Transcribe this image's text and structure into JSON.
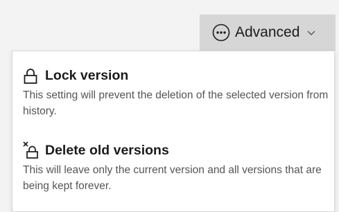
{
  "toolbar": {
    "advanced_label": "Advanced",
    "advanced_icon": "more-options-icon",
    "chevron_icon": "chevron-down-icon"
  },
  "menu": {
    "items": [
      {
        "title": "Lock version",
        "description": "This setting will prevent the deletion of the selected version from history.",
        "icon": "lock-icon"
      },
      {
        "title": "Delete old versions",
        "description": "This will leave only the current version and all versions that are being kept forever.",
        "icon": "delete-lock-icon"
      }
    ]
  },
  "colors": {
    "background": "#f3f3f3",
    "button_background": "#d6d6d6",
    "menu_background": "#ffffff",
    "text": "#1b1b1b",
    "description_text": "#555555"
  }
}
